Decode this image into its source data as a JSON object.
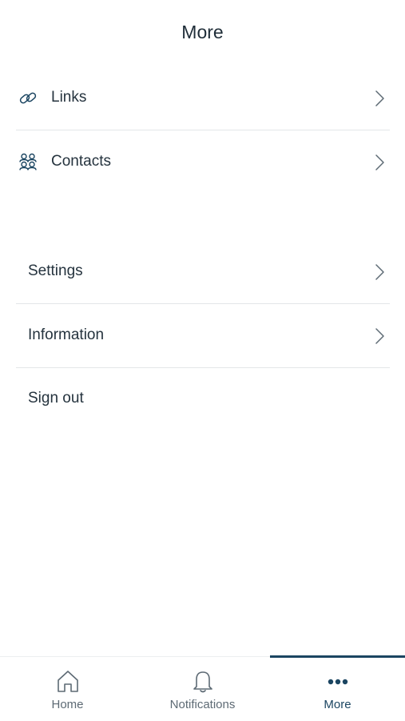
{
  "header": {
    "title": "More"
  },
  "menu": {
    "primary": [
      {
        "label": "Links",
        "icon": "link-icon"
      },
      {
        "label": "Contacts",
        "icon": "contacts-icon"
      }
    ],
    "secondary": [
      {
        "label": "Settings"
      },
      {
        "label": "Information"
      },
      {
        "label": "Sign out"
      }
    ]
  },
  "tabbar": {
    "tabs": [
      {
        "label": "Home",
        "icon": "home-icon",
        "active": false
      },
      {
        "label": "Notifications",
        "icon": "bell-icon",
        "active": false
      },
      {
        "label": "More",
        "icon": "more-dots-icon",
        "active": true
      }
    ]
  },
  "colors": {
    "accent": "#1b4561",
    "text": "#25333e",
    "muted": "#5d6a74",
    "divider": "#e3e6e8"
  }
}
